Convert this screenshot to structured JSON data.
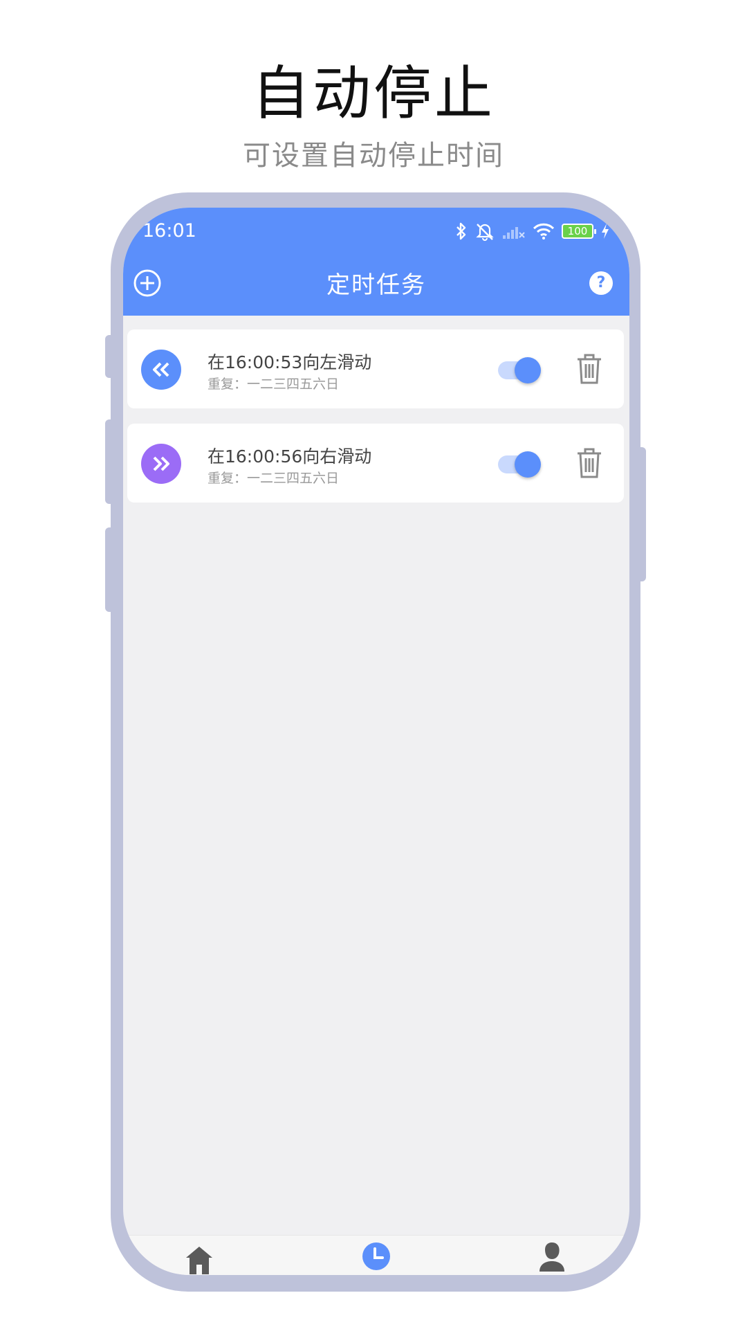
{
  "promo": {
    "title": "自动停止",
    "subtitle": "可设置自动停止时间"
  },
  "status_bar": {
    "time": "16:01",
    "battery": "100",
    "icons": [
      "bluetooth-icon",
      "mute-icon",
      "signal-icon",
      "wifi-icon",
      "battery-icon",
      "charging-icon"
    ]
  },
  "header": {
    "title": "定时任务",
    "add_icon": "add-circle-icon",
    "help_label": "?"
  },
  "tasks": [
    {
      "title": "在16:00:53向左滑动",
      "repeat": "重复：一二三四五六日",
      "direction_icon": "double-left-icon",
      "icon_color": "#5b8ffb",
      "enabled": true
    },
    {
      "title": "在16:00:56向右滑动",
      "repeat": "重复：一二三四五六日",
      "direction_icon": "double-right-icon",
      "icon_color": "#9b6cf6",
      "enabled": true
    }
  ],
  "bottom_nav": {
    "items": [
      "home-icon",
      "clock-icon",
      "profile-icon"
    ],
    "active_index": 1
  },
  "colors": {
    "accent": "#5b8ffb",
    "purple": "#9b6cf6",
    "frame": "#bec2da",
    "background": "#f0f0f2"
  }
}
